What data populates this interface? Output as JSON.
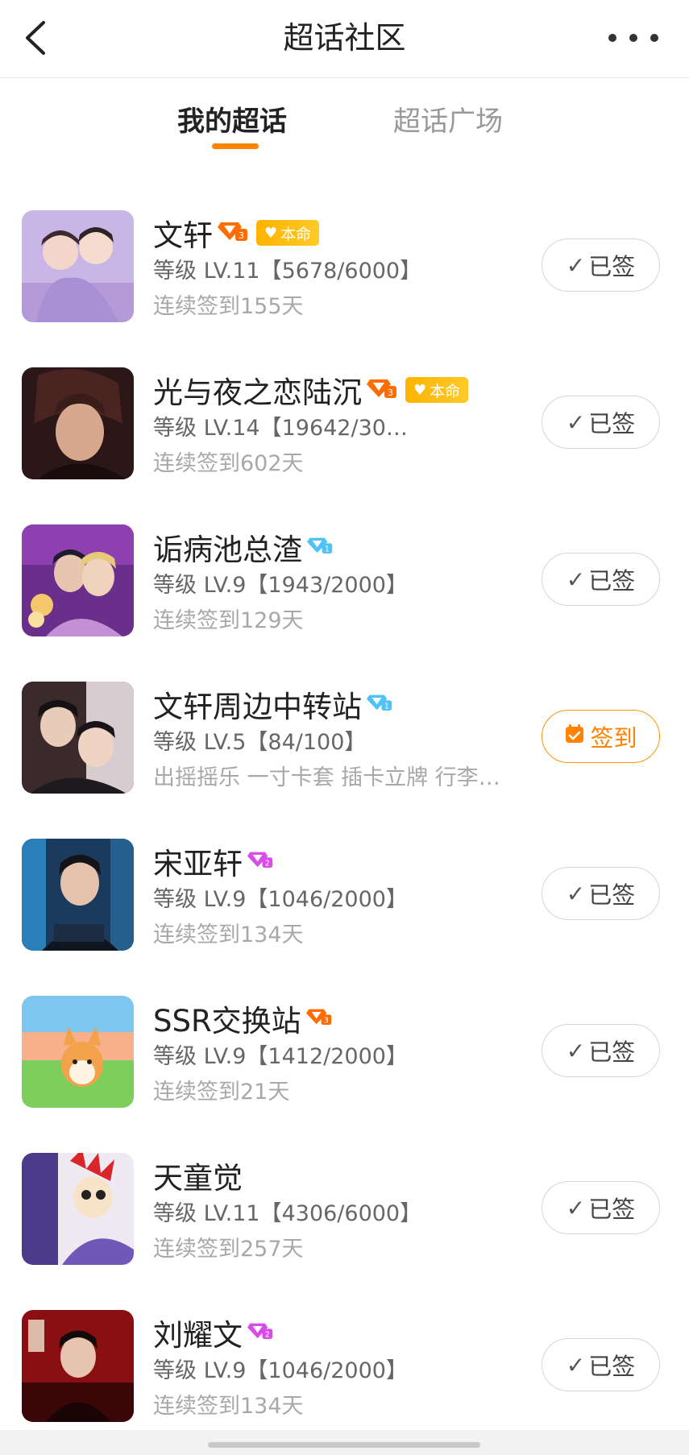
{
  "header": {
    "title": "超话社区"
  },
  "tabs": [
    {
      "label": "我的超话",
      "active": true
    },
    {
      "label": "超话广场",
      "active": false
    }
  ],
  "communities": [
    {
      "name": "文轩",
      "badge": "orange-diamond-icon",
      "benming": "本命",
      "level": "等级 LV.11【5678/6000】",
      "sub": "连续签到155天",
      "status": "已签",
      "signed": true
    },
    {
      "name": "光与夜之恋陆沉",
      "badge": "orange-diamond-icon",
      "benming": "本命",
      "level": "等级 LV.14【19642/30…",
      "sub": "连续签到602天",
      "status": "已签",
      "signed": true
    },
    {
      "name": "诟病池总渣",
      "badge": "blue-diamond-icon",
      "benming": "",
      "level": "等级 LV.9【1943/2000】",
      "sub": "连续签到129天",
      "status": "已签",
      "signed": true
    },
    {
      "name": "文轩周边中转站",
      "badge": "blue-diamond-icon",
      "benming": "",
      "level": "等级 LV.5【84/100】",
      "sub": "出摇摇乐 一寸卡套 插卡立牌 行李…",
      "status": "签到",
      "signed": false
    },
    {
      "name": "宋亚轩",
      "badge": "purple-diamond-icon",
      "benming": "",
      "level": "等级 LV.9【1046/2000】",
      "sub": "连续签到134天",
      "status": "已签",
      "signed": true
    },
    {
      "name": "SSR交换站",
      "badge": "orange-diamond-icon",
      "benming": "",
      "level": "等级 LV.9【1412/2000】",
      "sub": "连续签到21天",
      "status": "已签",
      "signed": true
    },
    {
      "name": "天童觉",
      "badge": "",
      "benming": "",
      "level": "等级 LV.11【4306/6000】",
      "sub": "连续签到257天",
      "status": "已签",
      "signed": true
    },
    {
      "name": "刘耀文",
      "badge": "purple-diamond-icon",
      "benming": "",
      "level": "等级 LV.9【1046/2000】",
      "sub": "连续签到134天",
      "status": "已签",
      "signed": true
    }
  ],
  "colors": {
    "accent": "#ff8200",
    "orange_badge": "#ff6d00",
    "blue_badge": "#4fc3f7",
    "purple_badge": "#d84de8",
    "benming_bg": "#ffbb00"
  }
}
